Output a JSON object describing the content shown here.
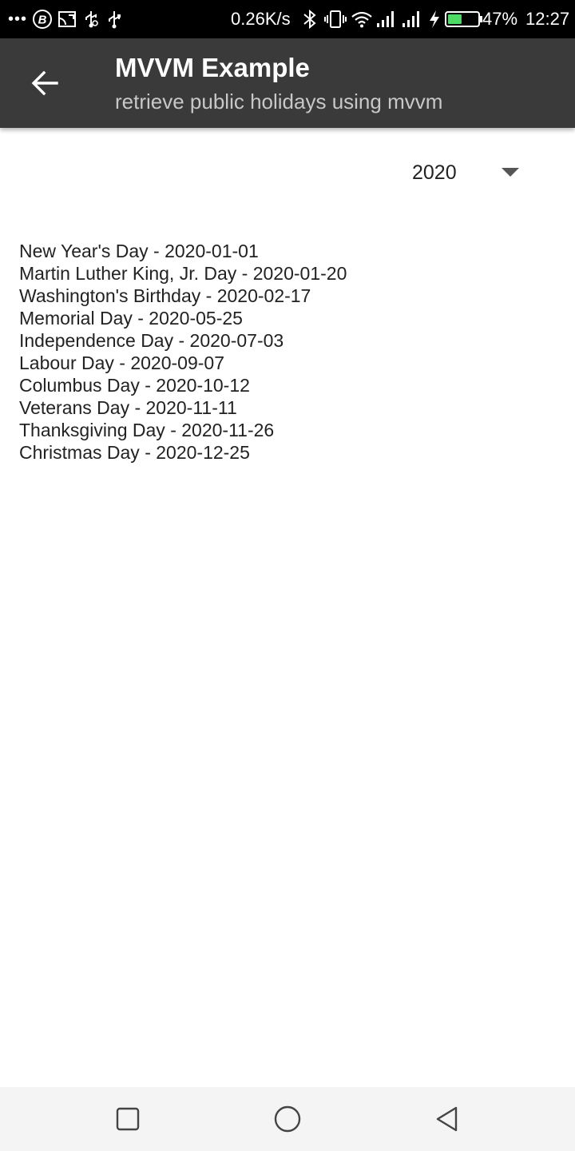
{
  "status_bar": {
    "network_speed": "0.26K/s",
    "battery_percent": "47%",
    "battery_level": 0.47,
    "time": "12:27",
    "overflow_dots": "•••",
    "icons": [
      "more-notifications-icon",
      "b-app-icon",
      "cast-icon",
      "usb-debug-icon",
      "usb-icon",
      "bluetooth-icon",
      "vibrate-icon",
      "wifi-icon",
      "signal-icon",
      "signal-icon-2",
      "charging-icon",
      "battery-icon"
    ],
    "battery_color": "#4cd964"
  },
  "app_bar": {
    "title": "MVVM Example",
    "subtitle": "retrieve public holidays using mvvm",
    "back_icon": "arrow-back-icon",
    "background_color": "#3a3a3a"
  },
  "year_spinner": {
    "selected_year": "2020",
    "caret_icon": "dropdown-caret-icon"
  },
  "holidays": [
    "New Year's Day - 2020-01-01",
    "Martin Luther King, Jr. Day - 2020-01-20",
    "Washington's Birthday - 2020-02-17",
    "Memorial Day - 2020-05-25",
    "Independence Day - 2020-07-03",
    "Labour Day - 2020-09-07",
    "Columbus Day - 2020-10-12",
    "Veterans Day - 2020-11-11",
    "Thanksgiving Day - 2020-11-26",
    "Christmas Day - 2020-12-25"
  ],
  "nav_bar": {
    "icons": [
      "recents-square-icon",
      "home-circle-icon",
      "back-triangle-icon"
    ]
  }
}
